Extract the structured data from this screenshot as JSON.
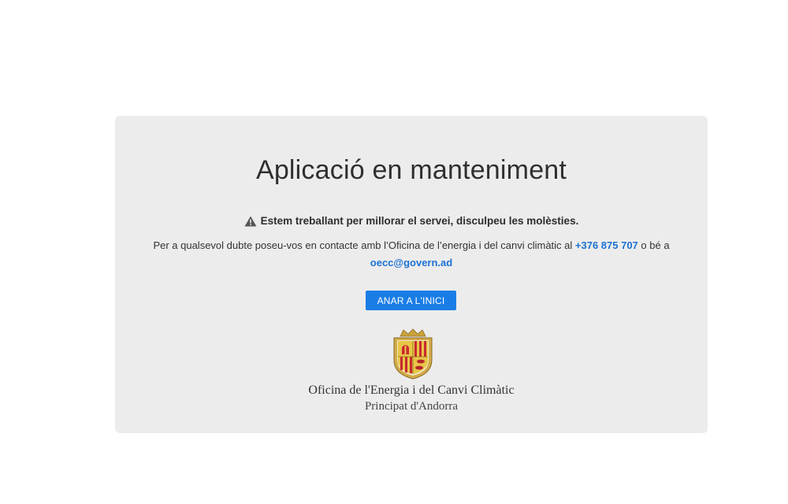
{
  "maintenance": {
    "title": "Aplicació en manteniment",
    "notice": "Estem treballant per millorar el servei, disculpeu les molèsties.",
    "contact_prefix": "Per a qualsevol dubte poseu-vos en contacte amb l’Oficina de l’energia i del canvi climàtic al ",
    "phone": "+376 875 707",
    "contact_middle": " o bé a ",
    "email": "oecc@govern.ad",
    "home_button_label": "ANAR A L'INICI"
  },
  "branding": {
    "office_name": "Oficina de l'Energia i del Canvi Climàtic",
    "office_subtitle": "Principat d'Andorra"
  },
  "icons": {
    "notice_icon": "warning-icon",
    "logo": "andorra-coat-of-arms"
  },
  "colors": {
    "card_background": "#ececec",
    "link": "#1c72d4",
    "button": "#1a7de6",
    "button_text": "#ffffff"
  }
}
